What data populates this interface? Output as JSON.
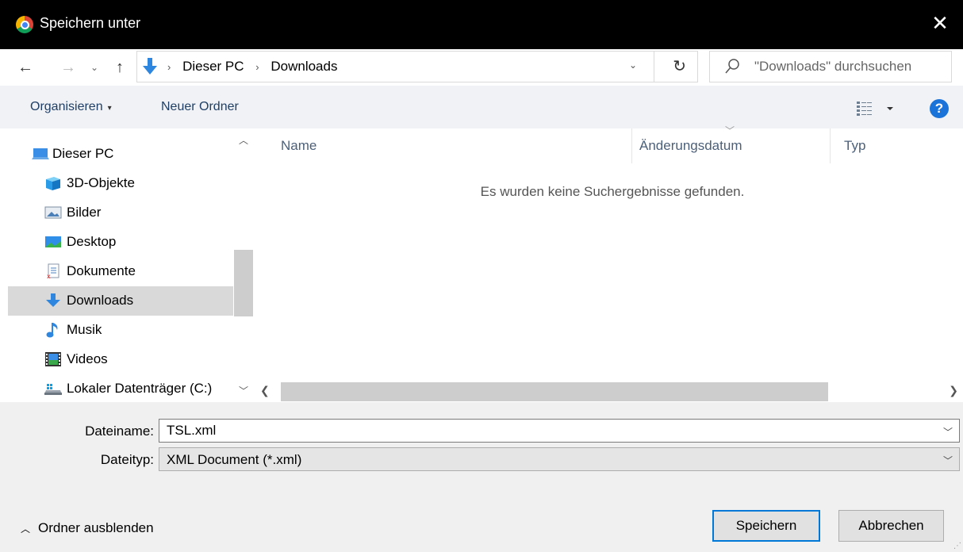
{
  "window": {
    "title": "Speichern unter",
    "close_glyph": "✕",
    "app_icon": "chrome-icon"
  },
  "address": {
    "icon": "downloads-icon",
    "crumbs": [
      "Dieser PC",
      "Downloads"
    ],
    "separator": "›",
    "dropdown_glyph": "⌄",
    "refresh_glyph": "↻"
  },
  "search": {
    "placeholder": "\"Downloads\" durchsuchen"
  },
  "nav": {
    "back": "←",
    "forward": "→",
    "recent": "⌄",
    "up": "↑"
  },
  "toolbar": {
    "organize_label": "Organisieren",
    "organize_caret": "▾",
    "new_folder_label": "Neuer Ordner",
    "help_label": "?"
  },
  "navpane": {
    "items": [
      {
        "label": "Dieser PC",
        "icon": "pc-icon",
        "selected": false
      },
      {
        "label": "3D-Objekte",
        "icon": "3d-objects-icon",
        "selected": false
      },
      {
        "label": "Bilder",
        "icon": "pictures-icon",
        "selected": false
      },
      {
        "label": "Desktop",
        "icon": "desktop-icon",
        "selected": false
      },
      {
        "label": "Dokumente",
        "icon": "documents-icon",
        "selected": false
      },
      {
        "label": "Downloads",
        "icon": "downloads-icon",
        "selected": true
      },
      {
        "label": "Musik",
        "icon": "music-icon",
        "selected": false
      },
      {
        "label": "Videos",
        "icon": "videos-icon",
        "selected": false
      },
      {
        "label": "Lokaler Datenträger (C:)",
        "icon": "drive-icon",
        "selected": false
      }
    ]
  },
  "filelist": {
    "columns": [
      "Name",
      "Änderungsdatum",
      "Typ"
    ],
    "empty_message": "Es wurden keine Suchergebnisse gefunden."
  },
  "form": {
    "filename_label": "Dateiname:",
    "filename_value": "TSL.xml",
    "filetype_label": "Dateityp:",
    "filetype_value": "XML Document (*.xml)"
  },
  "footer": {
    "hide_folders_label": "Ordner ausblenden",
    "save_label": "Speichern",
    "cancel_label": "Abbrechen"
  },
  "colors": {
    "accent": "#0078d7",
    "help": "#1a73d8",
    "selection": "#d9d9d9"
  }
}
